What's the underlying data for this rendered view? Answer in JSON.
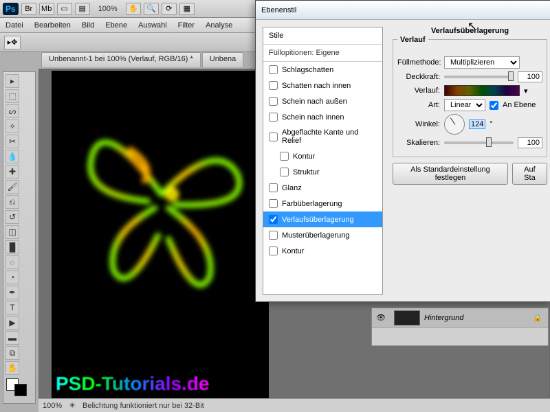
{
  "app": {
    "zoom": "100%"
  },
  "menu": [
    "Datei",
    "Bearbeiten",
    "Bild",
    "Ebene",
    "Auswahl",
    "Filter",
    "Analyse"
  ],
  "doc_tabs": [
    "Unbenannt-1 bei 100% (Verlauf, RGB/16) *",
    "Unbena"
  ],
  "canvas_text": "PSD-Tutorials.de",
  "status": {
    "zoom": "100%",
    "msg": "Belichtung funktioniert nur bei 32-Bit"
  },
  "dialog": {
    "title": "Ebenenstil",
    "styles_header": "Stile",
    "fill_options": "Füllopitionen: Eigene",
    "items": [
      {
        "label": "Schlagschatten",
        "checked": false,
        "indent": false
      },
      {
        "label": "Schatten nach innen",
        "checked": false,
        "indent": false
      },
      {
        "label": "Schein nach außen",
        "checked": false,
        "indent": false
      },
      {
        "label": "Schein nach innen",
        "checked": false,
        "indent": false
      },
      {
        "label": "Abgeflachte Kante und Relief",
        "checked": false,
        "indent": false
      },
      {
        "label": "Kontur",
        "checked": false,
        "indent": true
      },
      {
        "label": "Struktur",
        "checked": false,
        "indent": true
      },
      {
        "label": "Glanz",
        "checked": false,
        "indent": false
      },
      {
        "label": "Farbüberlagerung",
        "checked": false,
        "indent": false
      },
      {
        "label": "Verlaufsüberlagerung",
        "checked": true,
        "indent": false,
        "selected": true
      },
      {
        "label": "Musterüberlagerung",
        "checked": false,
        "indent": false
      },
      {
        "label": "Kontur",
        "checked": false,
        "indent": false
      }
    ],
    "group_heading": "Verlaufsüberlagerung",
    "subgroup": "Verlauf",
    "blend_label": "Füllmethode:",
    "blend_value": "Multiplizieren",
    "opacity_label": "Deckkraft:",
    "opacity_value": "100",
    "gradient_label": "Verlauf:",
    "style_label": "Art:",
    "style_value": "Linear",
    "align_label": "An Ebene",
    "angle_label": "Winkel:",
    "angle_value": "124",
    "angle_unit": "°",
    "scale_label": "Skalieren:",
    "scale_value": "100",
    "btn_default": "Als Standardeinstellung festlegen",
    "btn_reset": "Auf Sta"
  },
  "layers": {
    "name": "Hintergrund"
  }
}
